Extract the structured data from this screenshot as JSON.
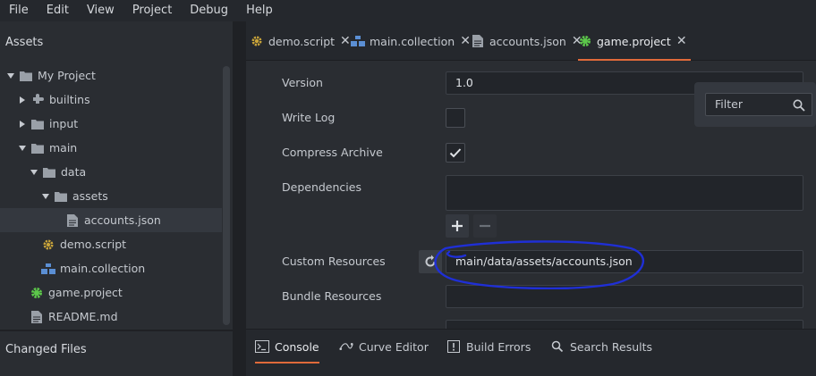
{
  "menu": [
    "File",
    "Edit",
    "View",
    "Project",
    "Debug",
    "Help"
  ],
  "left_panel": {
    "assets_title": "Assets",
    "changed_files_title": "Changed Files",
    "tree": [
      {
        "label": "My Project",
        "icon": "folder-icon",
        "expanded": true
      },
      {
        "label": "builtins",
        "icon": "builtins-puzzle-icon",
        "expanded": false
      },
      {
        "label": "input",
        "icon": "folder-icon",
        "expanded": false
      },
      {
        "label": "main",
        "icon": "folder-icon",
        "expanded": true
      },
      {
        "label": "data",
        "icon": "folder-icon",
        "expanded": true
      },
      {
        "label": "assets",
        "icon": "folder-icon",
        "expanded": true
      },
      {
        "label": "accounts.json",
        "icon": "file-icon",
        "selected": true
      },
      {
        "label": "demo.script",
        "icon": "script-gear-icon"
      },
      {
        "label": "main.collection",
        "icon": "collection-icon"
      },
      {
        "label": "game.project",
        "icon": "project-gear-icon"
      },
      {
        "label": "README.md",
        "icon": "file-icon"
      }
    ]
  },
  "tabs": [
    {
      "label": "demo.script",
      "icon": "script-gear-icon"
    },
    {
      "label": "main.collection",
      "icon": "collection-icon"
    },
    {
      "label": "accounts.json",
      "icon": "file-icon"
    },
    {
      "label": "game.project",
      "icon": "project-gear-icon",
      "active": true
    }
  ],
  "editor": {
    "version_label": "Version",
    "version_value": "1.0",
    "write_log_label": "Write Log",
    "write_log_checked": false,
    "compress_archive_label": "Compress Archive",
    "compress_archive_checked": true,
    "dependencies_label": "Dependencies",
    "custom_resources_label": "Custom Resources",
    "custom_resources_value": "main/data/assets/accounts.json",
    "bundle_resources_label": "Bundle Resources",
    "bundle_resources_value": ""
  },
  "filter": {
    "placeholder": "Filter"
  },
  "bottom_tabs": [
    {
      "label": "Console",
      "icon": "console-icon",
      "active": true
    },
    {
      "label": "Curve Editor",
      "icon": "curve-icon"
    },
    {
      "label": "Build Errors",
      "icon": "error-icon"
    },
    {
      "label": "Search Results",
      "icon": "search-icon"
    }
  ],
  "colors": {
    "accent": "#e06a3a",
    "annotation": "#1f2fd6",
    "project_green": "#5cc84a",
    "script_gold": "#c9a43a",
    "collection_blue": "#5b8fd4"
  }
}
